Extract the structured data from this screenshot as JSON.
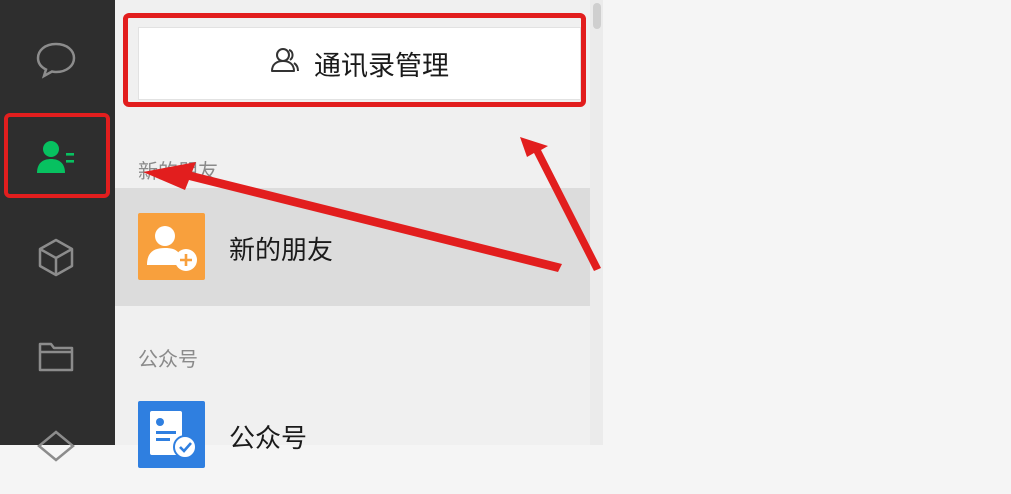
{
  "nav_rail": {
    "items": [
      {
        "name": "chats",
        "icon": "chat-bubble-icon"
      },
      {
        "name": "contacts",
        "icon": "contacts-icon",
        "active": true
      },
      {
        "name": "favorites",
        "icon": "cube-icon"
      },
      {
        "name": "files",
        "icon": "folder-icon"
      },
      {
        "name": "more",
        "icon": "diamond-icon"
      }
    ]
  },
  "contact_panel": {
    "manage_button_label": "通讯录管理",
    "manage_button_icon": "contacts-outline-icon",
    "sections": [
      {
        "title": "新的朋友",
        "items": [
          {
            "label": "新的朋友",
            "avatar_icon": "add-friend-icon",
            "avatar_color": "#f8a03d",
            "selected": true
          }
        ]
      },
      {
        "title": "公众号",
        "items": [
          {
            "label": "公众号",
            "avatar_icon": "official-account-icon",
            "avatar_color": "#2f7fe0"
          }
        ]
      }
    ]
  },
  "annotations": {
    "highlight_color": "#e21e1e"
  }
}
